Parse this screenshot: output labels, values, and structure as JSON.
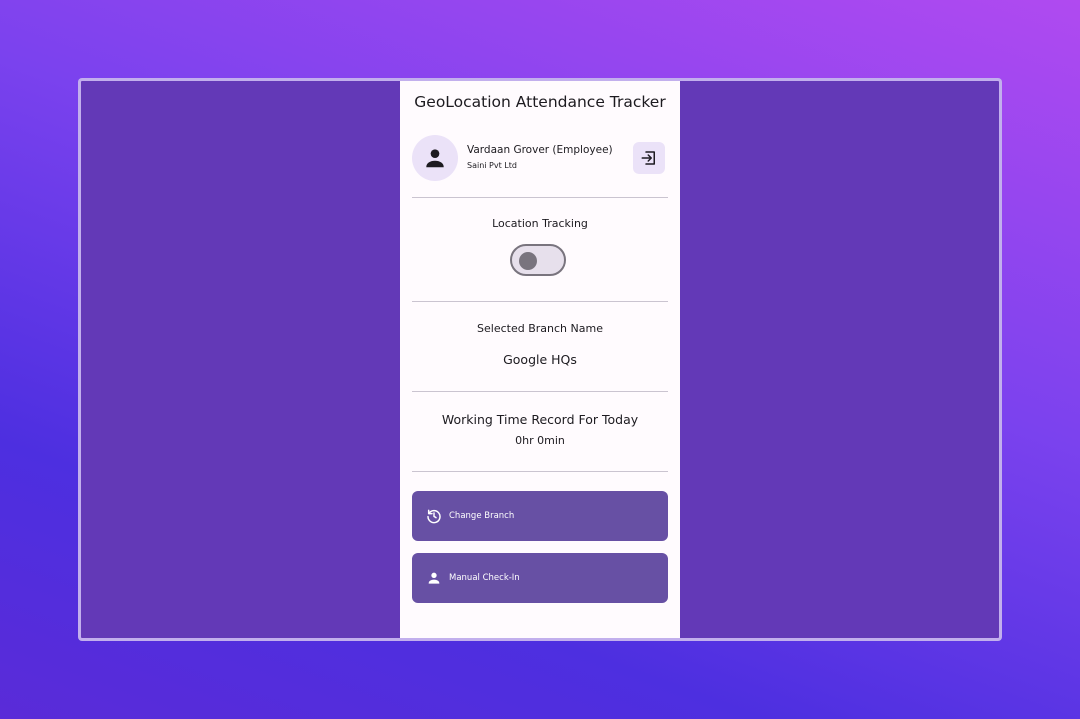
{
  "app": {
    "title": "GeoLocation Attendance Tracker"
  },
  "user": {
    "name": "Vardaan Grover (Employee)",
    "company": "Saini Pvt Ltd"
  },
  "location_tracking": {
    "label": "Location Tracking",
    "enabled": false
  },
  "branch": {
    "label": "Selected Branch Name",
    "name": "Google HQs"
  },
  "working_time": {
    "label": "Working Time Record For Today",
    "value": "0hr 0min"
  },
  "actions": {
    "change_branch": "Change Branch",
    "manual_checkin": "Manual Check-In"
  },
  "colors": {
    "primary": "#6750a4",
    "surface": "#fffbfe",
    "frame_bg": "#6339b7",
    "avatar_bg": "#ebe2f8"
  },
  "icons": {
    "avatar": "person-icon",
    "logout": "logout-icon",
    "change_branch": "history-icon",
    "manual_checkin": "person-icon"
  }
}
